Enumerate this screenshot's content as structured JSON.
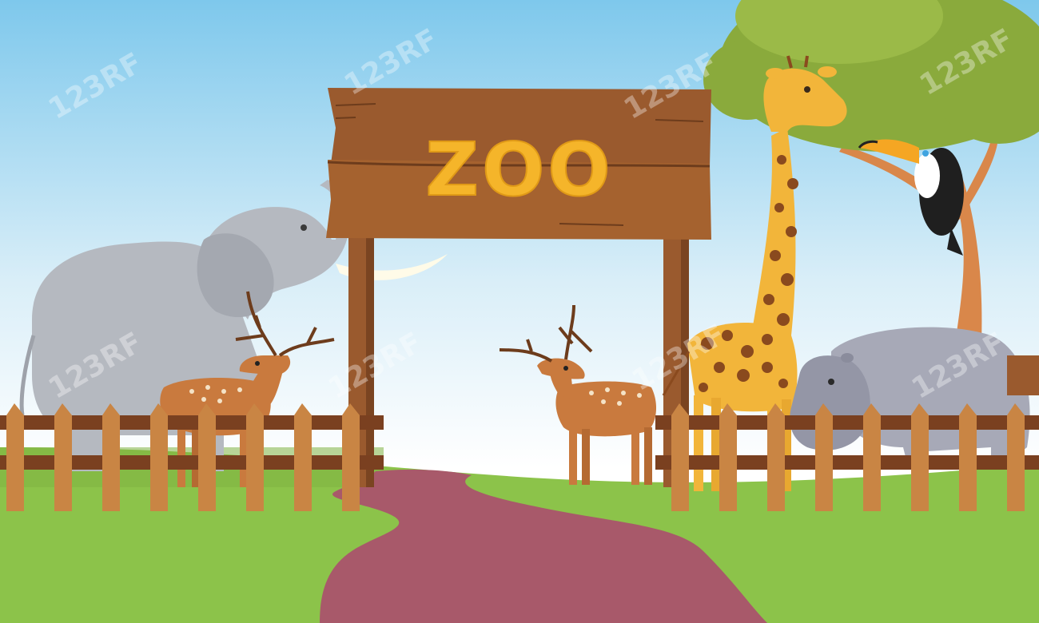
{
  "sign": {
    "text": "ZOO"
  },
  "watermark": {
    "text": "123RF"
  },
  "palette": {
    "sky_top": "#7ec8ec",
    "sky_bottom": "#ffffff",
    "grass": "#8cc34a",
    "grass_dark": "#6f9e33",
    "path": "#a8596a",
    "wood": "#9a5a2e",
    "wood_dark": "#6d3c1c",
    "fence": "#c98544",
    "fence_rail": "#7a4020",
    "sign_text": "#f5b52a",
    "elephant": "#b5b9c0",
    "deer": "#c97a3e",
    "giraffe": "#f2b53a",
    "giraffe_spots": "#8a4a1e",
    "hippo": "#a7a9b7",
    "tree_leaves": "#8aaa3c",
    "tree_trunk": "#d9874a",
    "toucan_beak": "#f5a623"
  },
  "animals": [
    "elephant",
    "deer",
    "deer",
    "giraffe",
    "hippo",
    "toucan"
  ]
}
